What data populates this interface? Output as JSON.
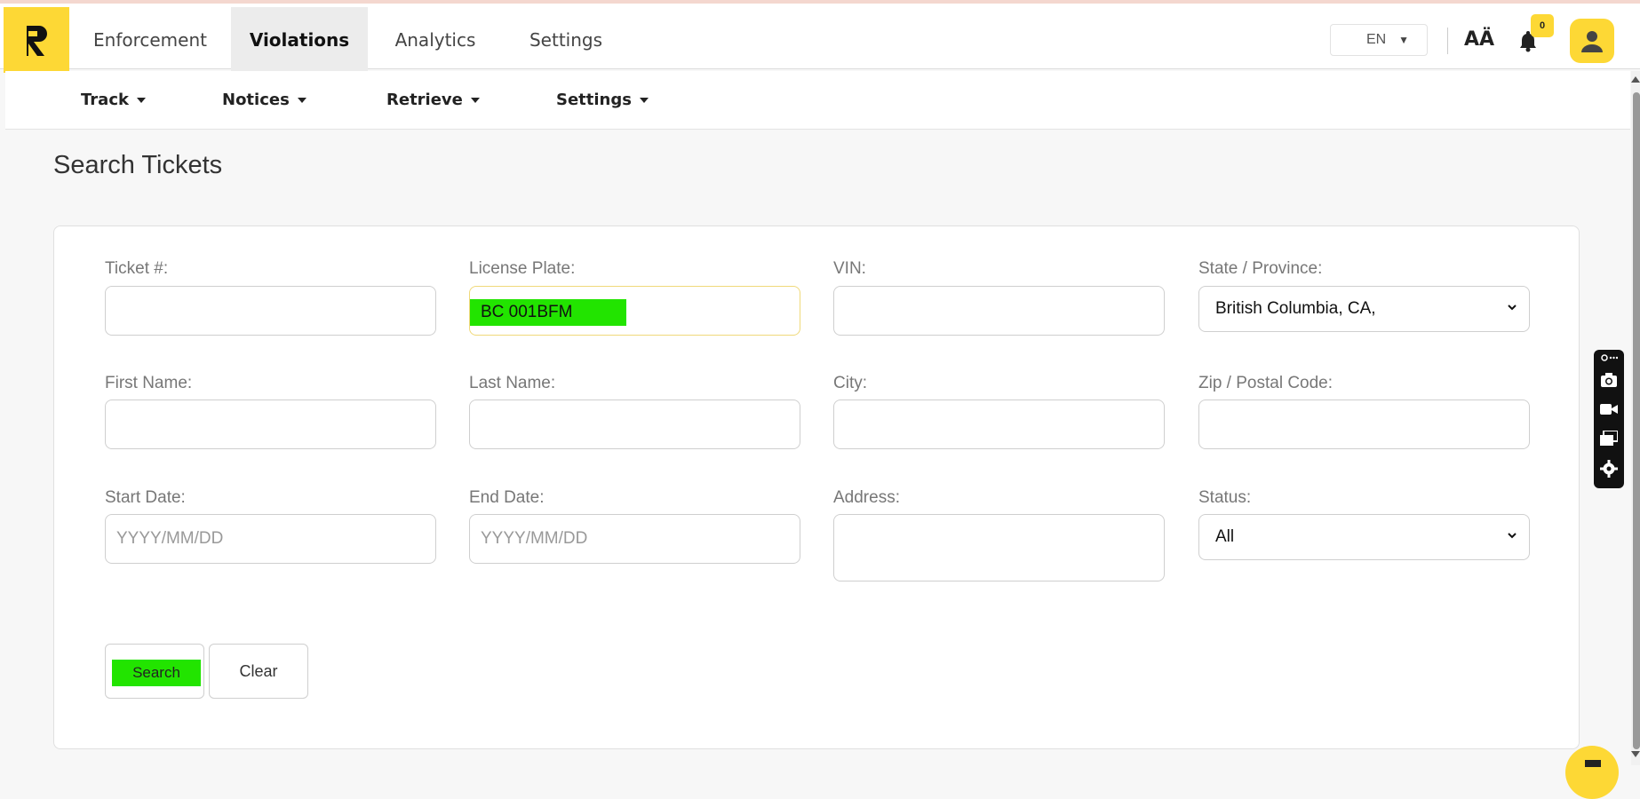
{
  "header": {
    "tabs": [
      {
        "label": "Enforcement"
      },
      {
        "label": "Violations"
      },
      {
        "label": "Analytics"
      },
      {
        "label": "Settings"
      }
    ],
    "language": "EN",
    "font_size_icon": "AÄ",
    "notification_count": "0"
  },
  "subnav": {
    "items": [
      {
        "label": "Track"
      },
      {
        "label": "Notices"
      },
      {
        "label": "Retrieve"
      },
      {
        "label": "Settings"
      }
    ]
  },
  "page": {
    "title": "Search Tickets"
  },
  "form": {
    "ticket_label": "Ticket #:",
    "ticket_value": "",
    "plate_label": "License Plate:",
    "plate_value": "BC 001BFM",
    "vin_label": "VIN:",
    "vin_value": "",
    "state_label": "State / Province:",
    "state_value": "British Columbia, CA,",
    "first_name_label": "First Name:",
    "first_name_value": "",
    "last_name_label": "Last Name:",
    "last_name_value": "",
    "city_label": "City:",
    "city_value": "",
    "zip_label": "Zip / Postal Code:",
    "zip_value": "",
    "start_date_label": "Start Date:",
    "start_date_placeholder": "YYYY/MM/DD",
    "end_date_label": "End Date:",
    "end_date_placeholder": "YYYY/MM/DD",
    "address_label": "Address:",
    "address_value": "",
    "status_label": "Status:",
    "status_value": "All",
    "search_label": "Search",
    "clear_label": "Clear"
  },
  "colors": {
    "brand_yellow": "#fdd835",
    "highlight_green": "#22e400"
  }
}
